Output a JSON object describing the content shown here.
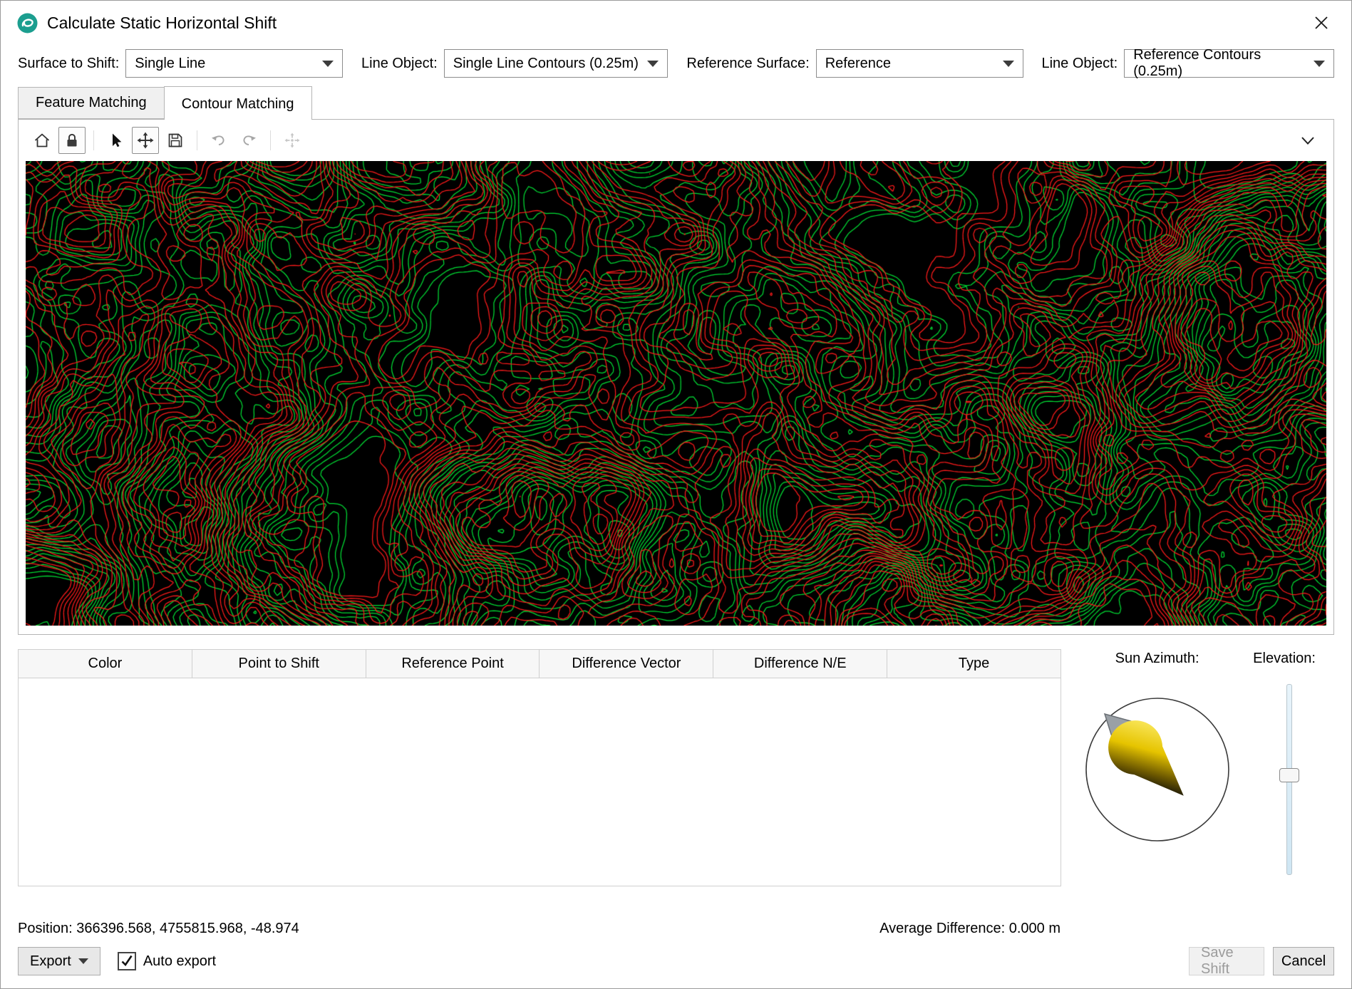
{
  "window": {
    "title": "Calculate Static Horizontal Shift",
    "app_icon_color": "#1b9e8f"
  },
  "controls": {
    "surface_to_shift_label": "Surface to Shift:",
    "surface_to_shift_value": "Single Line",
    "line_object1_label": "Line Object:",
    "line_object1_value": "Single Line Contours (0.25m)",
    "reference_surface_label": "Reference Surface:",
    "reference_surface_value": "Reference",
    "line_object2_label": "Line Object:",
    "line_object2_value": "Reference Contours (0.25m)"
  },
  "tabs": [
    {
      "label": "Feature Matching",
      "active": false
    },
    {
      "label": "Contour Matching",
      "active": true
    }
  ],
  "map": {
    "background": "#000000",
    "reference_color": "#00dd33",
    "shift_color": "#ff1a1a",
    "seed": 7,
    "levels": 20
  },
  "table": {
    "columns": [
      "Color",
      "Point to Shift",
      "Reference Point",
      "Difference Vector",
      "Difference N/E",
      "Type"
    ],
    "rows": []
  },
  "sun": {
    "azimuth_label": "Sun Azimuth:",
    "elevation_label": "Elevation:"
  },
  "status": {
    "position": "Position: 366396.568, 4755815.968, -48.974",
    "average_difference": "Average Difference: 0.000 m"
  },
  "footer": {
    "export_label": "Export",
    "auto_export_label": "Auto export",
    "auto_export_checked": true,
    "save_label": "Save Shift",
    "cancel_label": "Cancel"
  }
}
